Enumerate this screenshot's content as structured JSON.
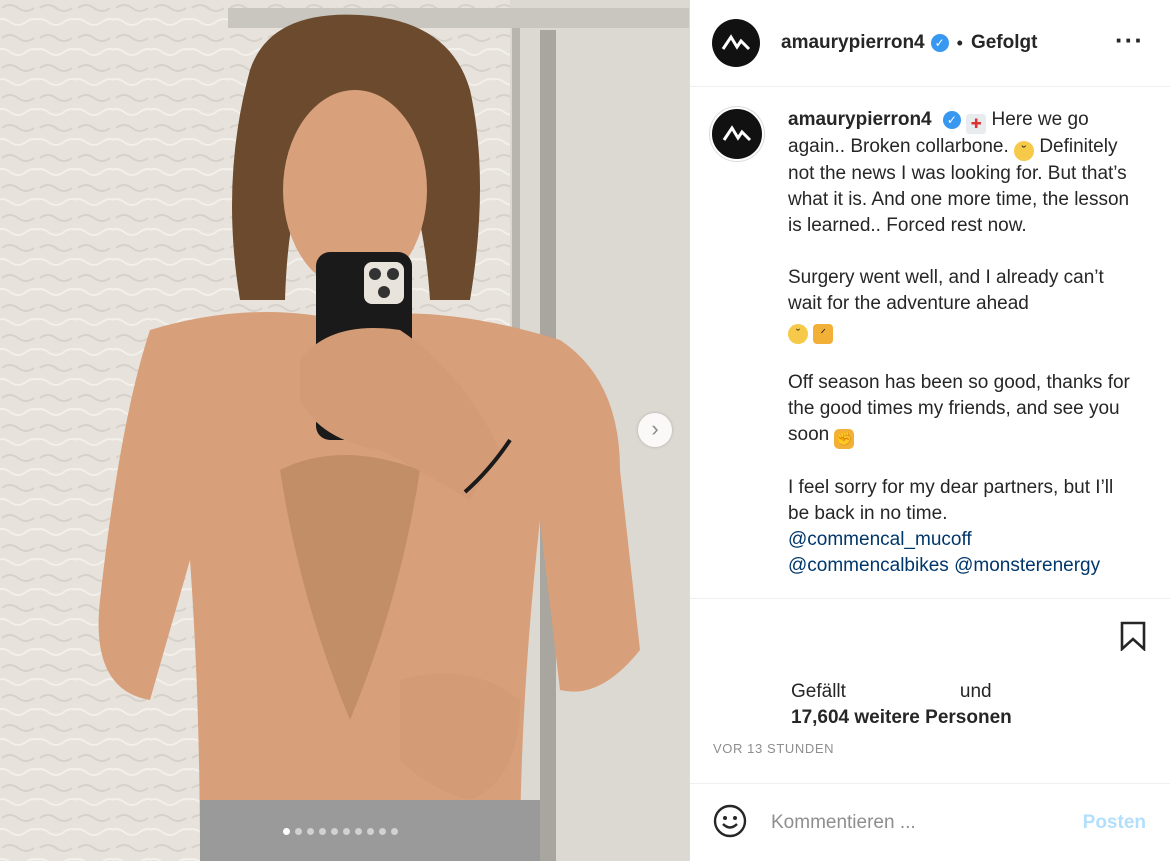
{
  "post": {
    "username": "amaurypierron4",
    "follow_status": "Gefolgt",
    "separator": "•",
    "more_label": "···"
  },
  "caption": {
    "username": "amaurypierron4",
    "line1": "Here we go again.. Broken collarbone.",
    "line2": "Definitely not the news I was looking for. But that’s what it is. And one more time, the lesson is learned.. Forced rest now.",
    "para2": "Surgery went well, and I already can’t wait for the adventure ahead",
    "para3": "Off season has been so good, thanks for the good times my friends, and see you soon",
    "para4": "I feel sorry for my dear partners, but I’ll be back in no time.",
    "mention1": "@commencal_mucoff",
    "mention2": "@commencalbikes",
    "mention3": "@monsterenergy"
  },
  "likes": {
    "prefix": "Gefällt",
    "connector": "und",
    "count_text": "17,604 weitere Personen"
  },
  "timestamp": "VOR 13 STUNDEN",
  "comment": {
    "placeholder": "Kommentieren ...",
    "post_label": "Posten"
  },
  "carousel": {
    "total_slides": 10,
    "active_index": 0
  },
  "colors": {
    "verified": "#3897f0",
    "mention": "#00376b",
    "post_disabled": "#b2dffc",
    "muted": "#8e8e8e"
  },
  "icons": [
    "verified-icon",
    "hospital-emoji",
    "tired-face-emoji",
    "steam-face-emoji",
    "flexed-biceps-emoji",
    "fist-bump-emoji",
    "bookmark-icon",
    "smile-icon",
    "chevron-right-icon",
    "more-icon"
  ]
}
